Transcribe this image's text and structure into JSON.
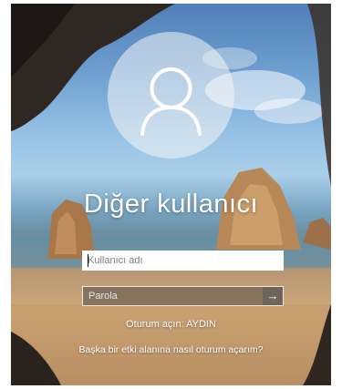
{
  "login": {
    "user_name": "Diğer kullanıcı",
    "username_placeholder": "Kullanıcı adı",
    "username_value": "",
    "password_placeholder": "Parola",
    "password_value": "",
    "submit_icon": "arrow-right-icon",
    "signin_to_label": "Oturum açın: AYDIN",
    "help_link": "Başka bir etki alanına nasıl oturum açarım?"
  },
  "colors": {
    "text": "#ffffff",
    "avatar_circle": "#f5f5f5"
  },
  "icons": {
    "avatar": "user-silhouette-icon"
  }
}
